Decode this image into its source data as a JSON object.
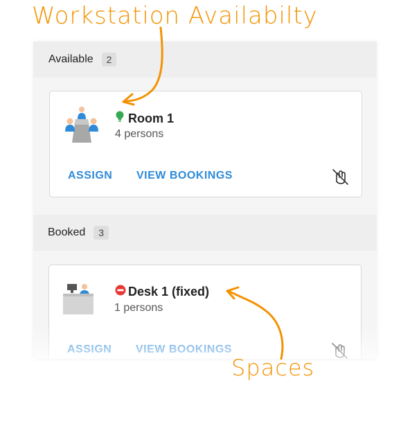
{
  "annotations": {
    "title": "Workstation Availabilty",
    "spaces": "Spaces",
    "color": "#f39200"
  },
  "sections": [
    {
      "title": "Available",
      "count": "2",
      "card": {
        "name": "Room 1",
        "capacity": "4 persons",
        "status": "available",
        "status_icon": "lightbulb-icon",
        "status_color": "#34a853",
        "type_icon": "meeting-room-icon",
        "assign_label": "ASSIGN",
        "view_label": "VIEW BOOKINGS",
        "action_icon": "hand-disabled-icon"
      }
    },
    {
      "title": "Booked",
      "count": "3",
      "card": {
        "name": "Desk 1 (fixed)",
        "capacity": "1 persons",
        "status": "booked",
        "status_icon": "no-entry-icon",
        "status_color": "#e53935",
        "type_icon": "desk-workstation-icon",
        "assign_label": "ASSIGN",
        "view_label": "VIEW BOOKINGS",
        "action_icon": "hand-disabled-icon"
      }
    }
  ],
  "colors": {
    "action_blue": "#2f8ad8",
    "header_bg": "#eeeeee",
    "panel_bg": "#f5f5f5"
  }
}
